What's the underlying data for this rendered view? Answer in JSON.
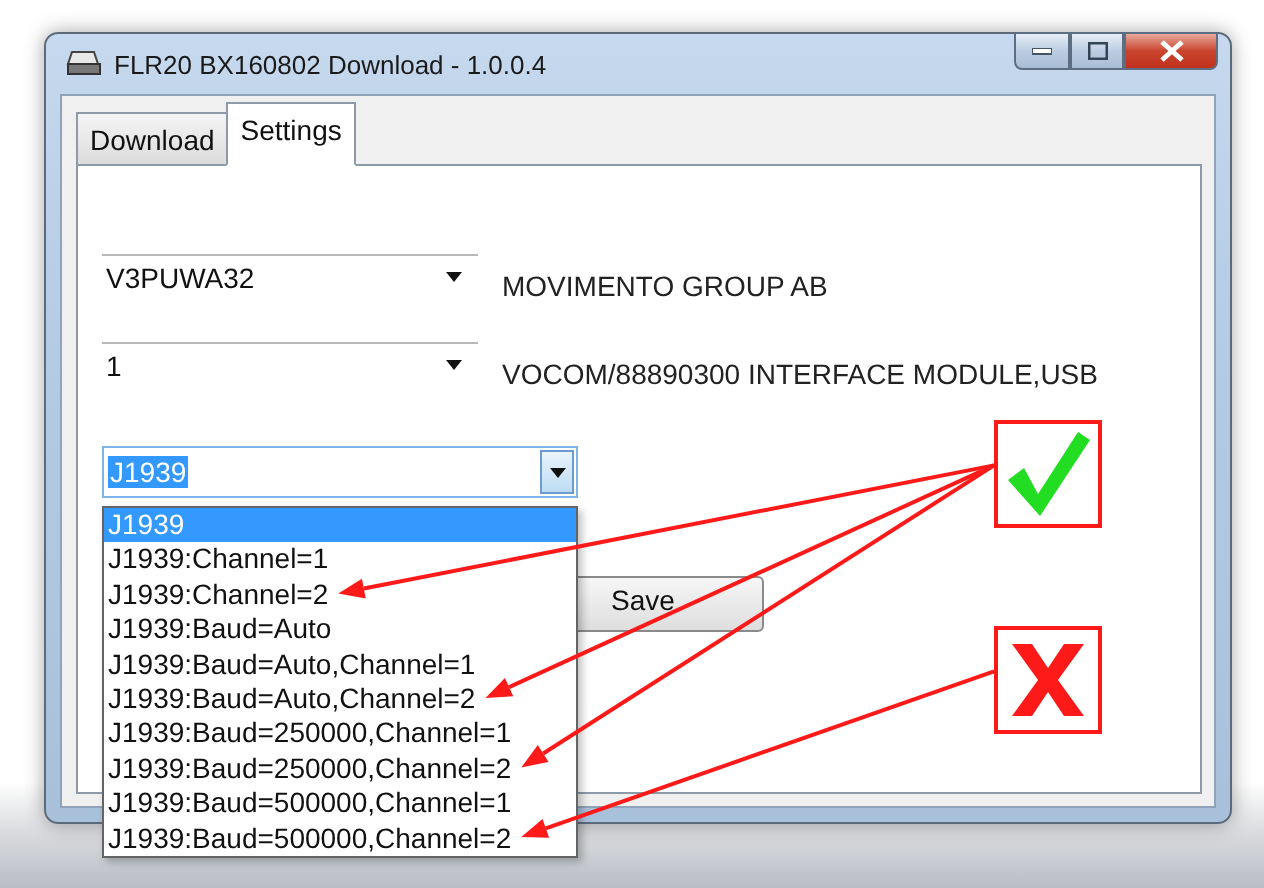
{
  "window": {
    "title": "FLR20 BX160802 Download - 1.0.0.4"
  },
  "tabs": [
    {
      "label": "Download",
      "selected": false
    },
    {
      "label": "Settings",
      "selected": true
    }
  ],
  "settings": [
    {
      "value": "V3PUWA32",
      "label": "MOVIMENTO GROUP AB"
    },
    {
      "value": "1",
      "label": "VOCOM/88890300 INTERFACE MODULE,USB"
    }
  ],
  "protocol": {
    "value": "J1939",
    "expanded": true,
    "options": [
      {
        "label": "J1939",
        "selected": true,
        "approved": false,
        "rejected": false
      },
      {
        "label": "J1939:Channel=1",
        "selected": false,
        "approved": false,
        "rejected": false
      },
      {
        "label": "J1939:Channel=2",
        "selected": false,
        "approved": true,
        "rejected": false
      },
      {
        "label": "J1939:Baud=Auto",
        "selected": false,
        "approved": false,
        "rejected": false
      },
      {
        "label": "J1939:Baud=Auto,Channel=1",
        "selected": false,
        "approved": false,
        "rejected": false
      },
      {
        "label": "J1939:Baud=Auto,Channel=2",
        "selected": false,
        "approved": true,
        "rejected": false
      },
      {
        "label": "J1939:Baud=250000,Channel=1",
        "selected": false,
        "approved": false,
        "rejected": false
      },
      {
        "label": "J1939:Baud=250000,Channel=2",
        "selected": false,
        "approved": true,
        "rejected": false
      },
      {
        "label": "J1939:Baud=500000,Channel=1",
        "selected": false,
        "approved": false,
        "rejected": false
      },
      {
        "label": "J1939:Baud=500000,Channel=2",
        "selected": false,
        "approved": false,
        "rejected": true
      }
    ]
  },
  "save_button": "Save",
  "annotations": [
    {
      "kind": "check"
    },
    {
      "kind": "cross"
    }
  ]
}
